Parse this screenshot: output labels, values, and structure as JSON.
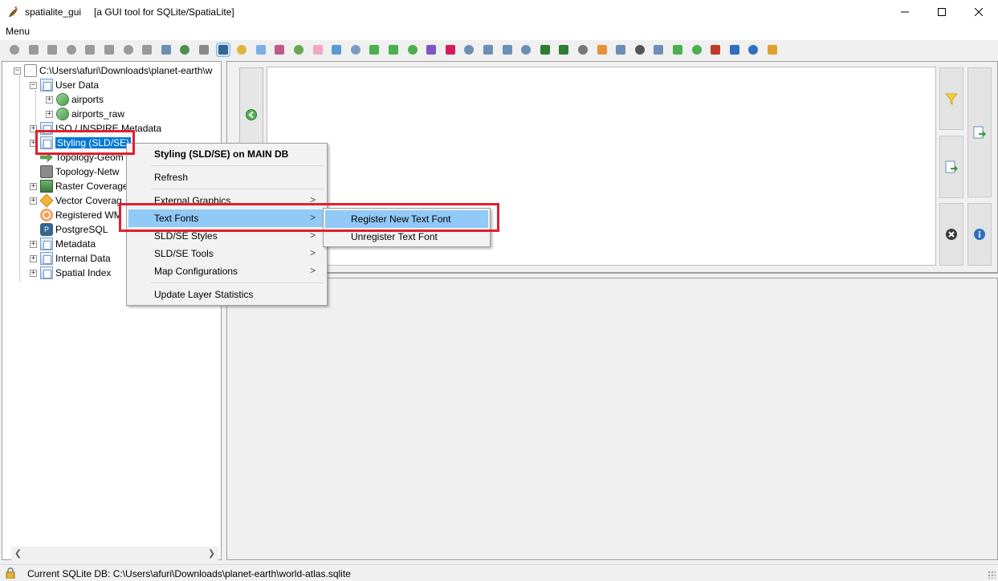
{
  "window": {
    "title": "spatialite_gui",
    "subtitle": "[a GUI tool for SQLite/SpatiaLite]",
    "controls": {
      "minimize": "minimize-icon",
      "maximize": "maximize-icon",
      "close": "close-icon"
    }
  },
  "menubar": {
    "label": "Menu"
  },
  "toolbar": {
    "button_count": 41
  },
  "tree": {
    "root": "C:\\Users\\afuri\\Downloads\\planet-earth\\w",
    "items": [
      {
        "label": "User Data"
      },
      {
        "label": "airports"
      },
      {
        "label": "airports_raw"
      },
      {
        "label": "ISO / INSPIRE Metadata"
      },
      {
        "label": "Styling (SLD/SE)"
      },
      {
        "label": "Topology-Geom"
      },
      {
        "label": "Topology-Netw"
      },
      {
        "label": "Raster Coverage"
      },
      {
        "label": "Vector Coverag"
      },
      {
        "label": "Registered WM"
      },
      {
        "label": "PostgreSQL"
      },
      {
        "label": "Metadata"
      },
      {
        "label": "Internal Data"
      },
      {
        "label": "Spatial Index"
      }
    ]
  },
  "context_menu": {
    "title": "Styling (SLD/SE) on MAIN DB",
    "items": [
      {
        "label": "Refresh"
      },
      {
        "label": "External Graphics"
      },
      {
        "label": "Text Fonts"
      },
      {
        "label": "SLD/SE Styles"
      },
      {
        "label": "SLD/SE Tools"
      },
      {
        "label": "Map Configurations"
      },
      {
        "label": "Update Layer Statistics"
      }
    ],
    "submenu_indicator": ">"
  },
  "submenu": {
    "items": [
      {
        "label": "Register New Text Font"
      },
      {
        "label": "Unregister Text Font"
      }
    ]
  },
  "status": {
    "text": "Current SQLite DB: C:\\Users\\afuri\\Downloads\\planet-earth\\world-atlas.sqlite"
  },
  "colors": {
    "selection": "#0078d7",
    "menu_highlight": "#91c9f7",
    "annotation": "#e0202e"
  }
}
